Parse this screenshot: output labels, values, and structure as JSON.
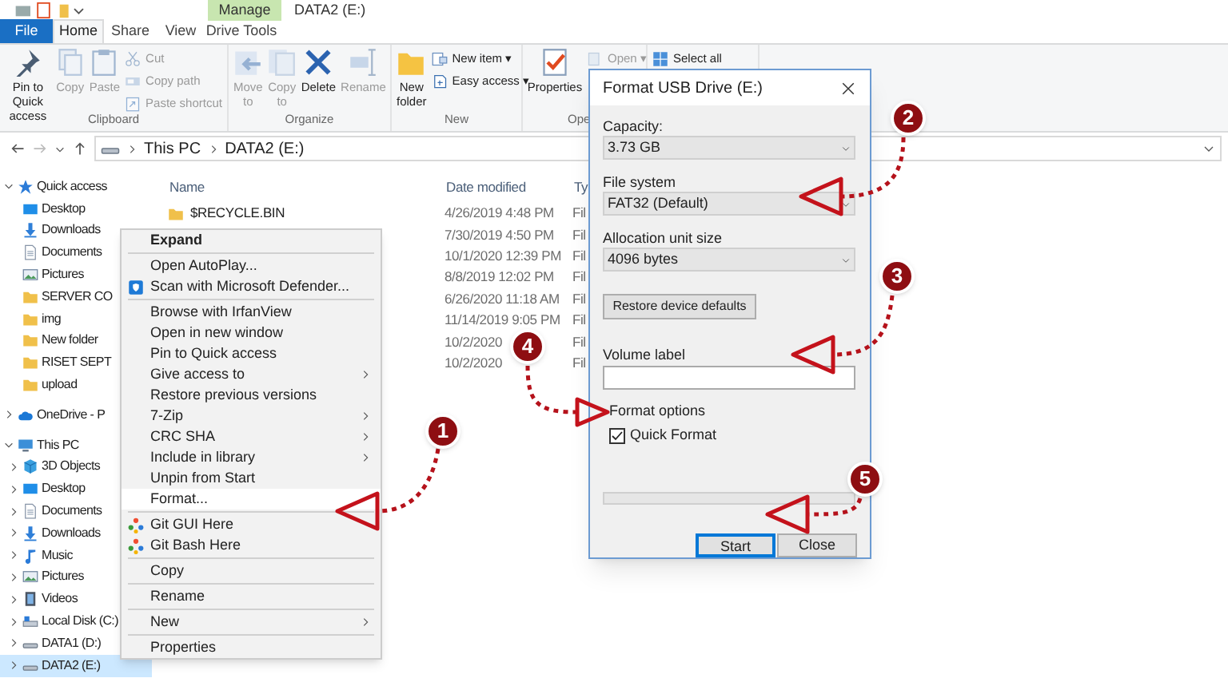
{
  "title_bar": {
    "contextual_tab": "Manage",
    "title": "DATA2 (E:)"
  },
  "tabs": [
    {
      "label": "File",
      "kind": "file",
      "selected": false
    },
    {
      "label": "Home",
      "kind": "tab",
      "selected": true
    },
    {
      "label": "Share",
      "kind": "tab",
      "selected": false
    },
    {
      "label": "View",
      "kind": "tab",
      "selected": false
    },
    {
      "label": "Drive Tools",
      "kind": "tab",
      "selected": false
    }
  ],
  "ribbon": [
    {
      "label": "Clipboard",
      "large": [
        {
          "label": "Pin to Quick access",
          "kind": "pin",
          "disabled": false
        },
        {
          "label": "Copy",
          "kind": "copy",
          "disabled": true
        },
        {
          "label": "Paste",
          "kind": "paste",
          "disabled": true
        }
      ],
      "small": [
        {
          "label": "Cut",
          "kind": "cut",
          "disabled": true
        },
        {
          "label": "Copy path",
          "kind": "copy-path",
          "disabled": true
        },
        {
          "label": "Paste shortcut",
          "kind": "paste-shortcut",
          "disabled": true
        }
      ]
    },
    {
      "label": "Organize",
      "large": [
        {
          "label": "Move to",
          "kind": "move",
          "disabled": true
        },
        {
          "label": "Copy to",
          "kind": "copy-to",
          "disabled": true
        },
        {
          "label": "Delete",
          "kind": "delete",
          "disabled": false
        },
        {
          "label": "Rename",
          "kind": "rename",
          "disabled": true
        }
      ]
    },
    {
      "label": "New",
      "large": [
        {
          "label": "New folder",
          "kind": "new-folder",
          "disabled": false
        }
      ],
      "small": [
        {
          "label": "New item ▾",
          "kind": "new-item",
          "disabled": false
        },
        {
          "label": "Easy access ▾",
          "kind": "easy-access",
          "disabled": false
        }
      ]
    },
    {
      "label": "Ope",
      "large": [
        {
          "label": "Properties",
          "kind": "properties",
          "disabled": false
        }
      ],
      "small": [
        {
          "label": "Open ▾",
          "kind": "open",
          "disabled": true
        }
      ]
    },
    {
      "small": [
        {
          "label": "Select all",
          "kind": "select-all",
          "disabled": false
        }
      ]
    }
  ],
  "breadcrumb": [
    "This PC",
    "DATA2 (E:)"
  ],
  "nav": [
    {
      "label": "Quick access",
      "kind": "star",
      "expanded": true,
      "selected": false,
      "children": [
        {
          "label": "Desktop",
          "kind": "desktop",
          "selected": false
        },
        {
          "label": "Downloads",
          "kind": "download",
          "selected": false
        },
        {
          "label": "Documents",
          "kind": "document",
          "selected": false
        },
        {
          "label": "Pictures",
          "kind": "pictures",
          "selected": false
        },
        {
          "label": "SERVER CO",
          "kind": "folder",
          "selected": false
        },
        {
          "label": "img",
          "kind": "folder",
          "selected": false
        },
        {
          "label": "New folder",
          "kind": "folder",
          "selected": false
        },
        {
          "label": "RISET SEPT",
          "kind": "folder",
          "selected": false
        },
        {
          "label": "upload",
          "kind": "folder",
          "selected": false
        }
      ]
    },
    {
      "label": "OneDrive - P",
      "kind": "cloud",
      "expanded": false,
      "selected": false
    },
    {
      "label": "This PC",
      "kind": "pc",
      "expanded": true,
      "selected": false,
      "children": [
        {
          "label": "3D Objects",
          "kind": "cube",
          "expanded": false,
          "selected": false
        },
        {
          "label": "Desktop",
          "kind": "desktop",
          "expanded": false,
          "selected": false
        },
        {
          "label": "Documents",
          "kind": "document",
          "expanded": false,
          "selected": false
        },
        {
          "label": "Downloads",
          "kind": "download",
          "expanded": false,
          "selected": false
        },
        {
          "label": "Music",
          "kind": "music",
          "expanded": false,
          "selected": false
        },
        {
          "label": "Pictures",
          "kind": "pictures",
          "expanded": false,
          "selected": false
        },
        {
          "label": "Videos",
          "kind": "video",
          "expanded": false,
          "selected": false
        },
        {
          "label": "Local Disk (C:)",
          "kind": "disk",
          "expanded": false,
          "selected": false
        },
        {
          "label": "DATA1 (D:)",
          "kind": "drive",
          "expanded": false,
          "selected": false
        },
        {
          "label": "DATA2 (E:)",
          "kind": "drive",
          "expanded": false,
          "selected": true
        }
      ]
    }
  ],
  "file_list": {
    "columns": [
      "Name",
      "Date modified",
      "Ty"
    ],
    "rows": [
      {
        "name": "$RECYCLE.BIN",
        "date_modified": "4/26/2019 4:48 PM",
        "type": "Fil"
      },
      {
        "date_modified": "7/30/2019 4:50 PM",
        "type": "Fil"
      },
      {
        "date_modified": "10/1/2020 12:39 PM",
        "type": "Fil"
      },
      {
        "date_modified": "8/8/2019 12:02 PM",
        "type": "Fil"
      },
      {
        "date_modified": "6/26/2020 11:18 AM",
        "type": "Fil"
      },
      {
        "date_modified": "11/14/2019 9:05 PM",
        "type": "Fil"
      },
      {
        "date_modified": "10/2/2020",
        "type": "Fil"
      },
      {
        "date_modified": "10/2/2020",
        "type": "Fil"
      }
    ]
  },
  "context_menu": [
    {
      "kind": "item",
      "label": "Expand",
      "bold": true,
      "highlighted": false
    },
    {
      "kind": "separator"
    },
    {
      "kind": "item",
      "label": "Open AutoPlay...",
      "highlighted": false
    },
    {
      "kind": "shield-item",
      "label": "Scan with Microsoft Defender...",
      "highlighted": false
    },
    {
      "kind": "separator"
    },
    {
      "kind": "item",
      "label": "Browse with IrfanView",
      "highlighted": false
    },
    {
      "kind": "item",
      "label": "Open in new window",
      "highlighted": false
    },
    {
      "kind": "item",
      "label": "Pin to Quick access",
      "highlighted": false
    },
    {
      "kind": "item",
      "label": "Give access to",
      "submenu": true,
      "highlighted": false
    },
    {
      "kind": "item",
      "label": "Restore previous versions",
      "highlighted": false
    },
    {
      "kind": "item",
      "label": "7-Zip",
      "submenu": true,
      "highlighted": false
    },
    {
      "kind": "item",
      "label": "CRC SHA",
      "submenu": true,
      "highlighted": false
    },
    {
      "kind": "item",
      "label": "Include in library",
      "submenu": true,
      "highlighted": false
    },
    {
      "kind": "item",
      "label": "Unpin from Start",
      "highlighted": false
    },
    {
      "kind": "item",
      "label": "Format...",
      "highlighted": true
    },
    {
      "kind": "separator"
    },
    {
      "kind": "git-item",
      "label": "Git GUI Here",
      "highlighted": false
    },
    {
      "kind": "git-item",
      "label": "Git Bash Here",
      "highlighted": false
    },
    {
      "kind": "separator"
    },
    {
      "kind": "item",
      "label": "Copy",
      "highlighted": false
    },
    {
      "kind": "separator"
    },
    {
      "kind": "item",
      "label": "Rename",
      "highlighted": false
    },
    {
      "kind": "separator"
    },
    {
      "kind": "item",
      "label": "New",
      "submenu": true,
      "highlighted": false
    },
    {
      "kind": "separator"
    },
    {
      "kind": "item",
      "label": "Properties",
      "highlighted": false
    }
  ],
  "dialog": {
    "title": "Format USB Drive (E:)",
    "controls": [
      {
        "kind": "select",
        "label": "Capacity:",
        "value": "3.73 GB"
      },
      {
        "kind": "select",
        "label": "File system",
        "value": "FAT32 (Default)"
      },
      {
        "kind": "select",
        "label": "Allocation unit size",
        "value": "4096 bytes"
      },
      {
        "kind": "button",
        "label": "Restore device defaults"
      },
      {
        "kind": "text",
        "label": "Volume label"
      }
    ],
    "format_options": {
      "label": "Format options",
      "checkbox": {
        "label": "Quick Format",
        "checked": true
      }
    },
    "progress": {
      "level": 0
    },
    "buttons": [
      {
        "label": "Start",
        "default": true
      },
      {
        "label": "Close",
        "default": false
      }
    ]
  },
  "annotations": [
    {
      "number": "1"
    },
    {
      "number": "2"
    },
    {
      "number": "3"
    },
    {
      "number": "4"
    },
    {
      "number": "5"
    }
  ]
}
